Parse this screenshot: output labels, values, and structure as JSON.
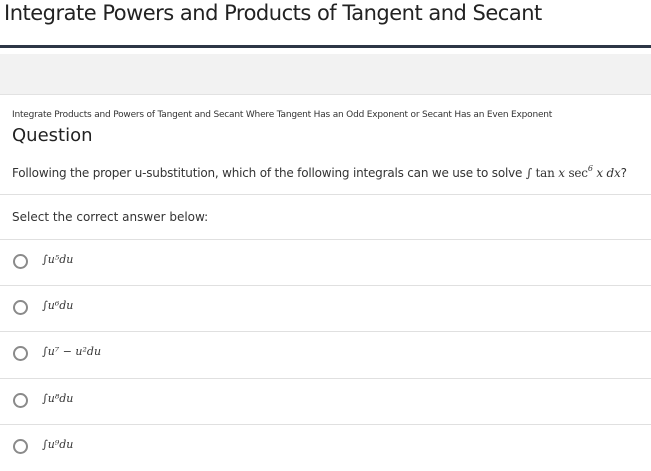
{
  "header": {
    "title": "Integrate Powers and Products of Tangent and Secant"
  },
  "breadcrumb": {
    "text": "Integrate Products and Powers of Tangent and Secant Where Tangent Has an Odd Exponent or Secant Has an Even Exponent"
  },
  "question": {
    "heading": "Question",
    "prompt_text": "Following the proper u-substitution, which of the following integrals can we use to solve ",
    "integral": {
      "integral_sign": "∫",
      "tan": "tan",
      "var1": "x",
      "sec": "sec",
      "power": "6",
      "var2": "x",
      "dx": "dx",
      "qmark": "?"
    }
  },
  "answers": {
    "prompt": "Select the correct answer below:",
    "options": [
      {
        "label": "∫u⁵du",
        "selected": false
      },
      {
        "label": "∫u⁶du",
        "selected": false
      },
      {
        "label": "∫u⁷ − u²du",
        "selected": false
      },
      {
        "label": "∫u⁸du",
        "selected": false
      },
      {
        "label": "∫u⁹du",
        "selected": false
      }
    ]
  },
  "colors": {
    "title_rule": "#2d3646",
    "band": "#f2f2f2",
    "radio_border": "#8a8a8a"
  }
}
